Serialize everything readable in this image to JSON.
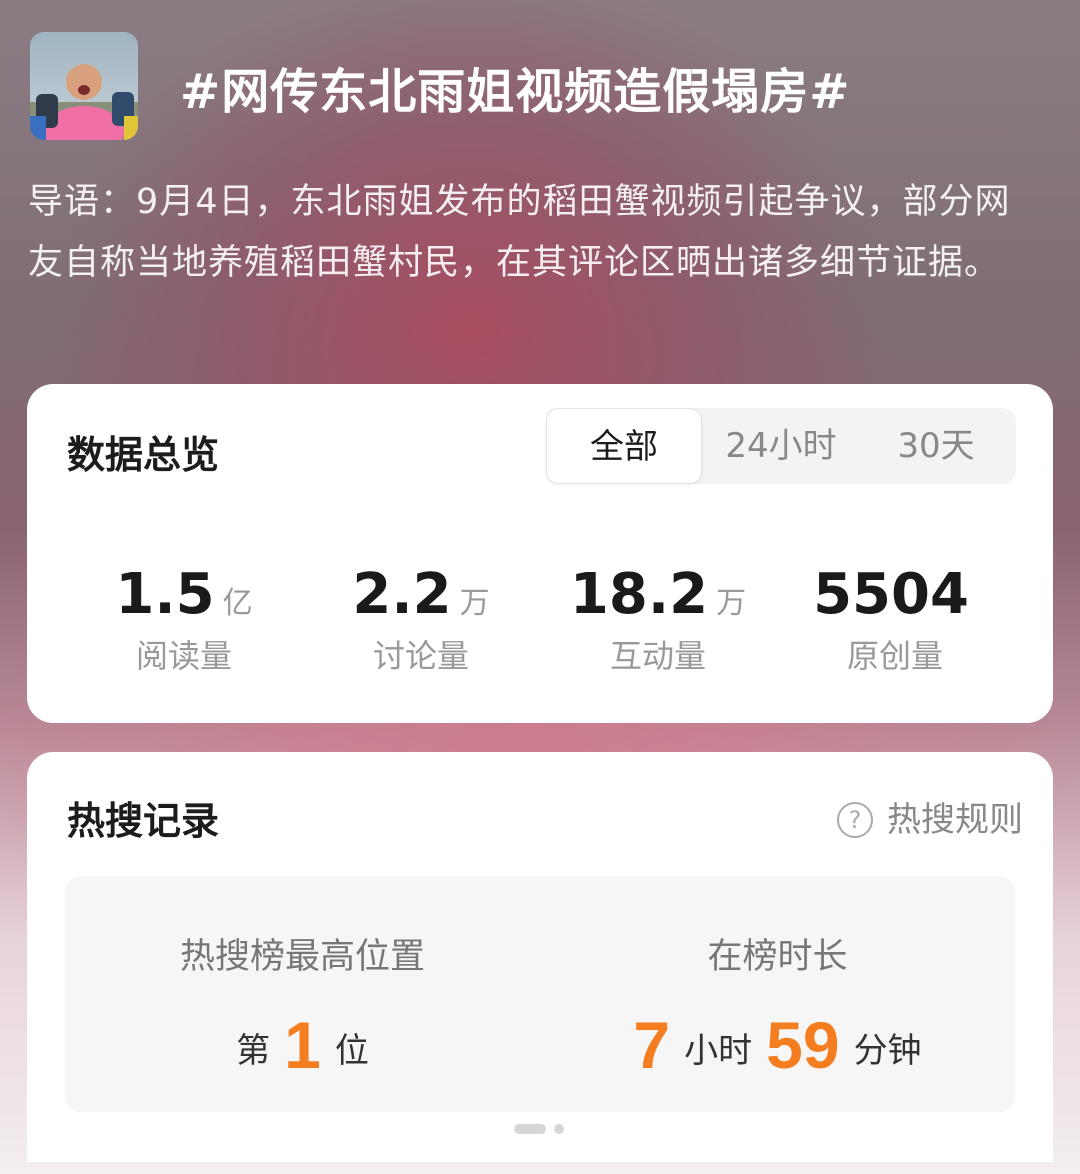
{
  "header": {
    "title": "#网传东北雨姐视频造假塌房#",
    "intro": "导语：9月4日，东北雨姐发布的稻田蟹视频引起争议，部分网友自称当地养殖稻田蟹村民，在其评论区晒出诸多细节证据。"
  },
  "overview": {
    "title": "数据总览",
    "tabs": [
      "全部",
      "24小时",
      "30天"
    ],
    "active_tab": "全部",
    "stats": [
      {
        "value": "1.5",
        "unit": "亿",
        "label": "阅读量"
      },
      {
        "value": "2.2",
        "unit": "万",
        "label": "讨论量"
      },
      {
        "value": "18.2",
        "unit": "万",
        "label": "互动量"
      },
      {
        "value": "5504",
        "unit": "",
        "label": "原创量"
      }
    ]
  },
  "hot_search": {
    "title": "热搜记录",
    "rules_label": "热搜规则",
    "rules_icon": "question-circle-icon",
    "highest": {
      "label": "热搜榜最高位置",
      "prefix": "第",
      "value": "1",
      "suffix": "位"
    },
    "duration": {
      "label": "在榜时长",
      "hours": "7",
      "hours_unit": "小时",
      "minutes": "59",
      "minutes_unit": "分钟"
    },
    "accent_color": "#f47d1f"
  }
}
